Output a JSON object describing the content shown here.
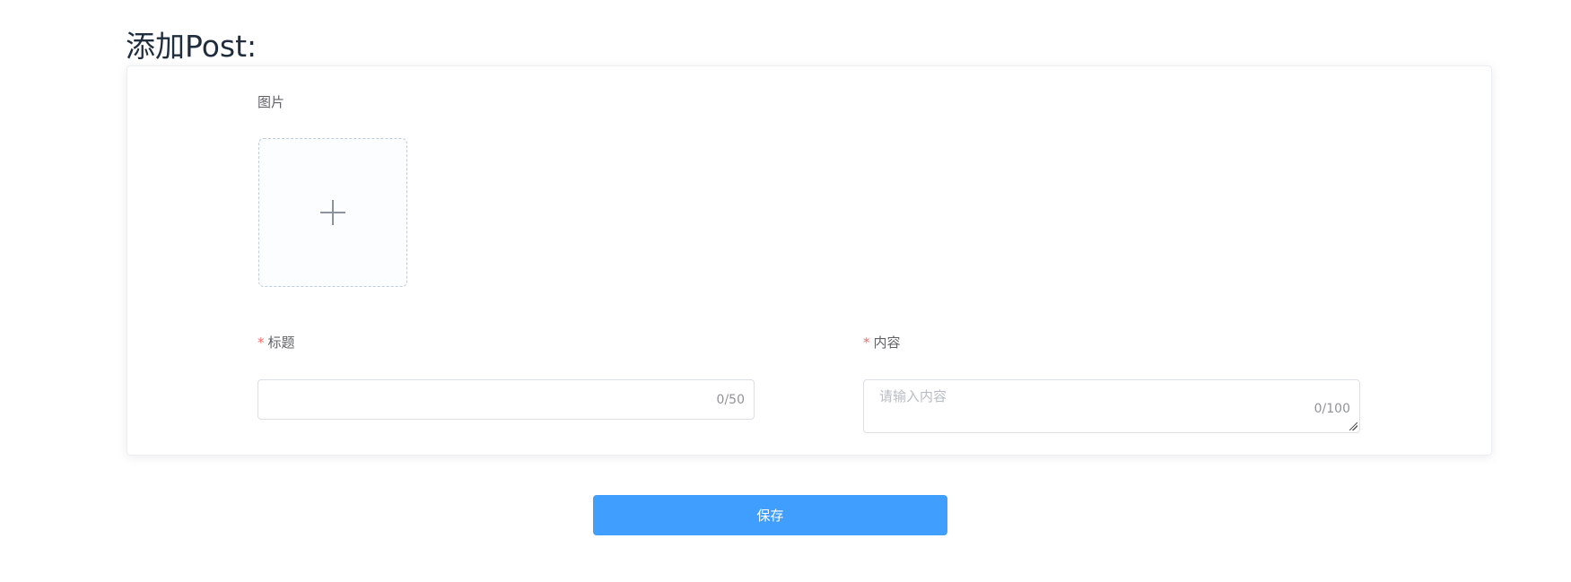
{
  "page": {
    "title": "添加Post:"
  },
  "form": {
    "image": {
      "label": "图片"
    },
    "title_field": {
      "required_mark": "*",
      "label": "标题",
      "value": "",
      "placeholder": "",
      "counter": "0/50"
    },
    "content_field": {
      "required_mark": "*",
      "label": "内容",
      "value": "",
      "placeholder": "请输入内容",
      "counter": "0/100"
    }
  },
  "actions": {
    "save_label": "保存"
  },
  "icons": {
    "upload": "plus-icon",
    "textarea_resize": "resize-grip-icon"
  },
  "colors": {
    "primary": "#409eff",
    "required": "#f56c6c",
    "border": "#dcdfe6",
    "upload_border": "#c0ccda"
  }
}
